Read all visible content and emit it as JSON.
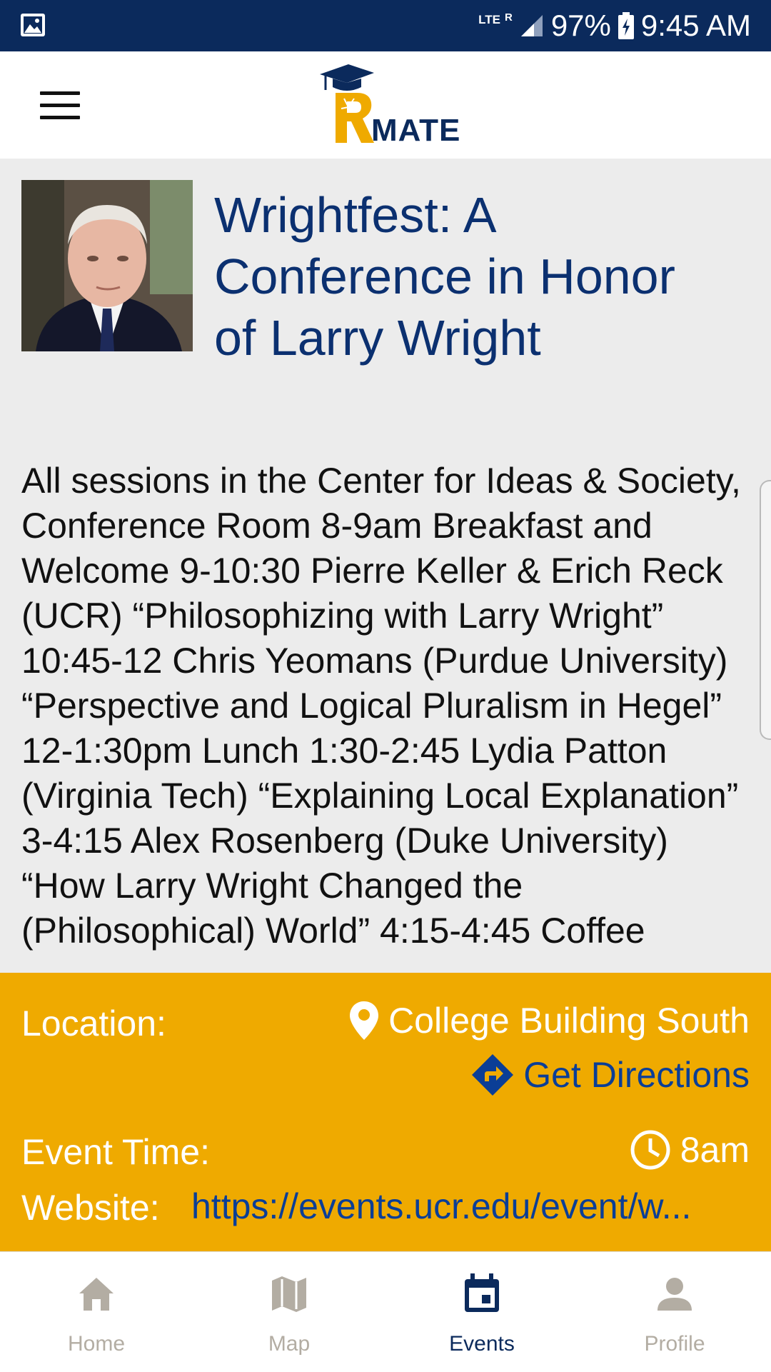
{
  "status_bar": {
    "network": "LTE",
    "roaming": "R",
    "battery": "97%",
    "time": "9:45 AM"
  },
  "header": {
    "menu_icon": "hamburger-menu-icon",
    "logo_text": "MATE"
  },
  "event": {
    "title": "Wrightfest: A Conference in Honor of Larry Wright",
    "description": "All sessions in the Center for Ideas & Society, Conference Room 8-9am Breakfast and Welcome 9-10:30 Pierre Keller & Erich Reck (UCR) “Philosophizing with Larry Wright” 10:45-12 Chris Yeomans (Purdue University) “Perspective and Logical Pluralism in Hegel” 12-1:30pm Lunch 1:30-2:45 Lydia Patton (Virginia Tech) “Explaining Local Explanation” 3-4:15 Alex Rosenberg (Duke University) “How Larry Wright Changed the (Philosophical) World” 4:15-4:45 Coffee"
  },
  "info": {
    "location_label": "Location:",
    "location_value": "College Building South",
    "directions_label": "Get Directions",
    "time_label": "Event Time:",
    "time_value": "8am",
    "website_label": "Website:",
    "website_value": "https://events.ucr.edu/event/w..."
  },
  "nav": {
    "items": [
      {
        "label": "Home",
        "icon": "home-icon"
      },
      {
        "label": "Map",
        "icon": "map-icon"
      },
      {
        "label": "Events",
        "icon": "calendar-icon"
      },
      {
        "label": "Profile",
        "icon": "person-icon"
      }
    ],
    "active": "Events"
  },
  "colors": {
    "navy": "#0b2a5c",
    "gold": "#efaa00",
    "link": "#0b3e96",
    "background": "#ececec"
  }
}
